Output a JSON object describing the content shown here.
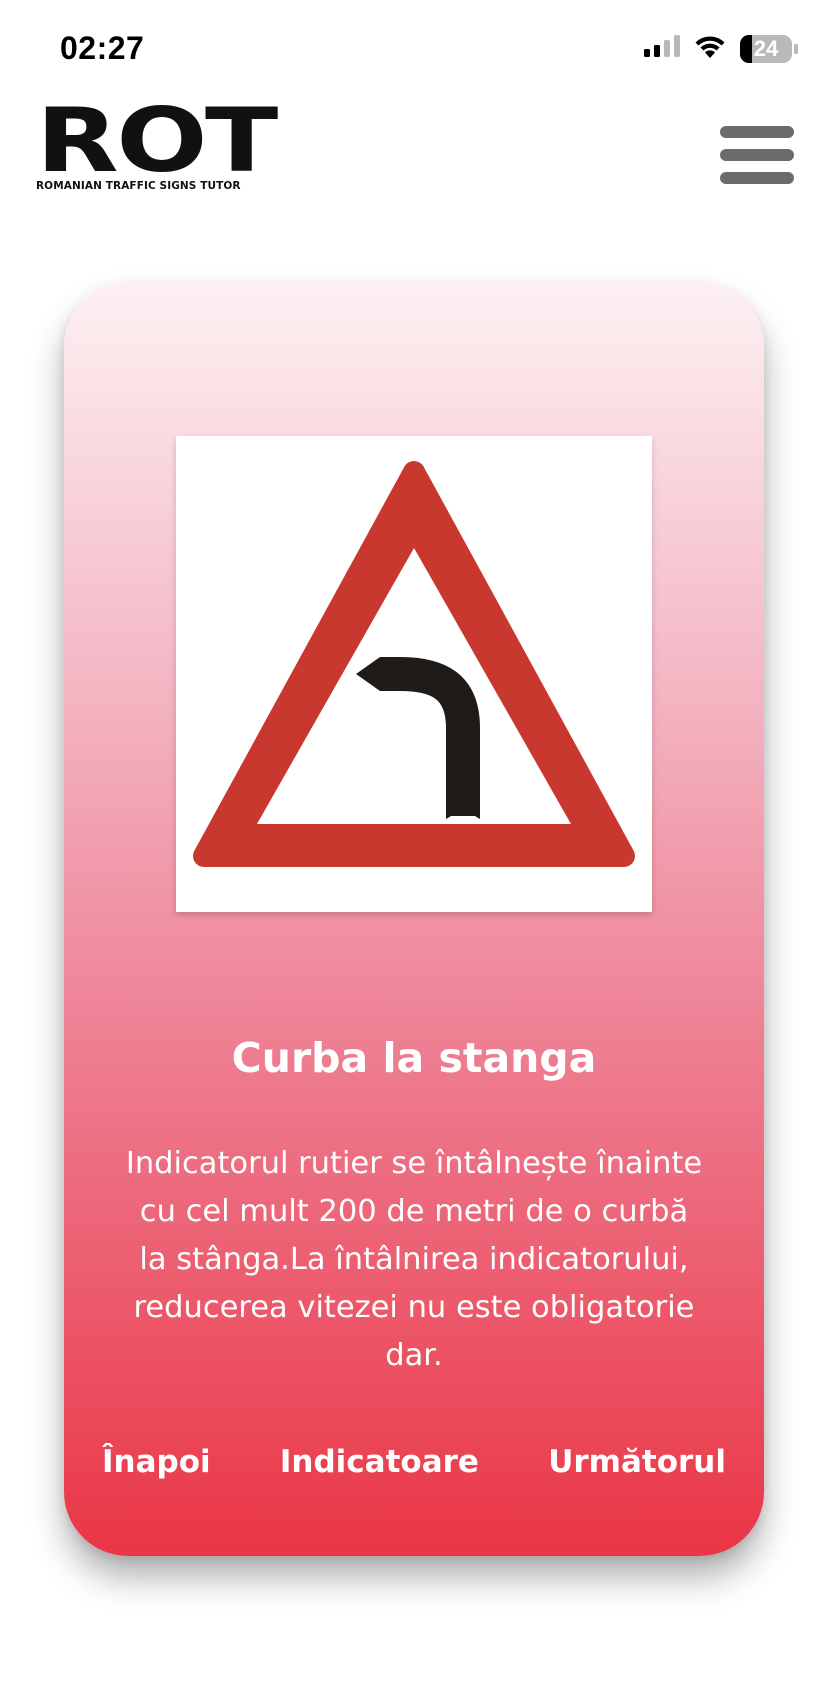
{
  "status_bar": {
    "time": "02:27",
    "battery_level": "24",
    "battery_fraction": 0.24,
    "signal_icon": "cellular-signal-icon",
    "wifi_icon": "wifi-icon",
    "battery_icon": "battery-icon"
  },
  "header": {
    "logo_text": "ROT",
    "logo_subtitle": "ROMANIAN TRAFFIC SIGNS TUTOR",
    "menu_icon": "hamburger-menu-icon"
  },
  "card": {
    "sign_image": "left-curve-warning-sign",
    "title": "Curba la stanga",
    "description": "Indicatorul rutier se întâlnește înainte cu cel mult 200 de metri de o curbă la stânga.La întâlnirea indicatorului, reducerea vitezei nu este obligatorie dar.",
    "nav": {
      "back": "Înapoi",
      "signs": "Indicatoare",
      "next": "Următorul"
    }
  },
  "colors": {
    "card_top": "#fdf1f3",
    "card_bottom": "#ea3545",
    "sign_red": "#c9382f",
    "sign_arrow": "#1e1b18",
    "menu_gray": "#6b6b6b"
  }
}
